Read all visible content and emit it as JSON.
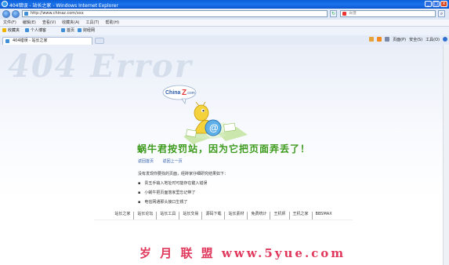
{
  "window": {
    "title": "404错误 - 站长之家 - Windows Internet Explorer",
    "buttons": [
      "_",
      "□",
      "x"
    ]
  },
  "address_bar": {
    "url": "http://www.chinaz.com/xxx",
    "search_placeholder": "百度"
  },
  "menu": [
    "文件(F)",
    "编辑(E)",
    "查看(V)",
    "收藏夹(A)",
    "工具(T)",
    "帮助(H)"
  ],
  "favorites_bar": {
    "favorites_label": "收藏夹",
    "items": [
      "个人博客",
      "首页",
      "财经网"
    ]
  },
  "tab": {
    "title": "404错误 - 站长之家"
  },
  "command_bar": {
    "items": [
      "页面(P)",
      "安全(S)",
      "工具(O)"
    ]
  },
  "page": {
    "watermark": "404 Error",
    "logo_text": "China",
    "logo_z": "Z",
    "logo_com": ".com",
    "headline": "蜗牛君按罚站，因为它把页面弄丢了！",
    "links": [
      "返回首页",
      "返回上一页"
    ],
    "description": "没有发现你要找的页面，经砖家仔细研究结果如下：",
    "reasons": [
      "贵玉手输入地址时可能存在键入错误",
      "小蜗牛把页面落家里忘记带了",
      "电信网通那头接口生锈了"
    ],
    "footer_nav": [
      "站长之家",
      "站长论坛",
      "站长工具",
      "站长交易",
      "源码下载",
      "站长素材",
      "免费统计",
      "王机师",
      "王机之家",
      "BBSMAX"
    ],
    "site_watermark": "岁 月 联 盟   www.5yue.com"
  }
}
